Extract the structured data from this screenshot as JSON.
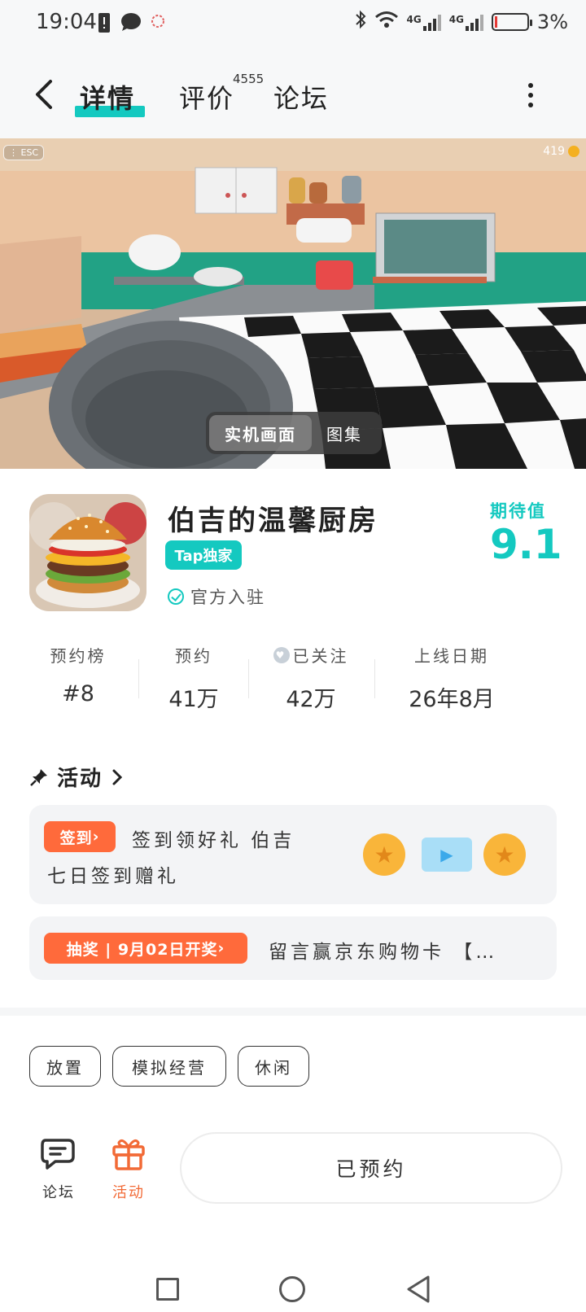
{
  "status_bar": {
    "time": "19:04",
    "network_1": "4G",
    "network_2": "4G",
    "battery_percent": "3%"
  },
  "header": {
    "tabs": [
      {
        "label": "详情",
        "active": true
      },
      {
        "label": "评价",
        "badge": "4555"
      },
      {
        "label": "论坛"
      }
    ]
  },
  "media": {
    "esc_label": "ESC",
    "coin_count": "419",
    "toggle": {
      "real_label": "实机画面",
      "gallery_label": "图集"
    }
  },
  "game": {
    "title": "伯吉的温馨厨房",
    "badge": "Tap独家",
    "official_label": "官方入驻",
    "expect_label": "期待值",
    "expect_value": "9.1"
  },
  "stats": [
    {
      "label": "预约榜",
      "value": "#8"
    },
    {
      "label": "预约",
      "value": "41万"
    },
    {
      "label": "已关注",
      "value": "42万"
    },
    {
      "label": "上线日期",
      "value": "26年8月"
    }
  ],
  "activity": {
    "title": "活动",
    "card1": {
      "tag": "签到",
      "line1": "签到领好礼 伯吉",
      "line2": "七日签到赠礼"
    },
    "card2": {
      "tag": "抽奖 | 9月02日开奖",
      "text": "留言赢京东购物卡 【…"
    }
  },
  "tags": [
    "放置",
    "模拟经营",
    "休闲"
  ],
  "bottom": {
    "forum_label": "论坛",
    "activity_label": "活动",
    "reserve_label": "已预约"
  },
  "colors": {
    "accent": "#14c9c0",
    "orange": "#ff6a3b",
    "activity_nav": "#f26a36"
  }
}
